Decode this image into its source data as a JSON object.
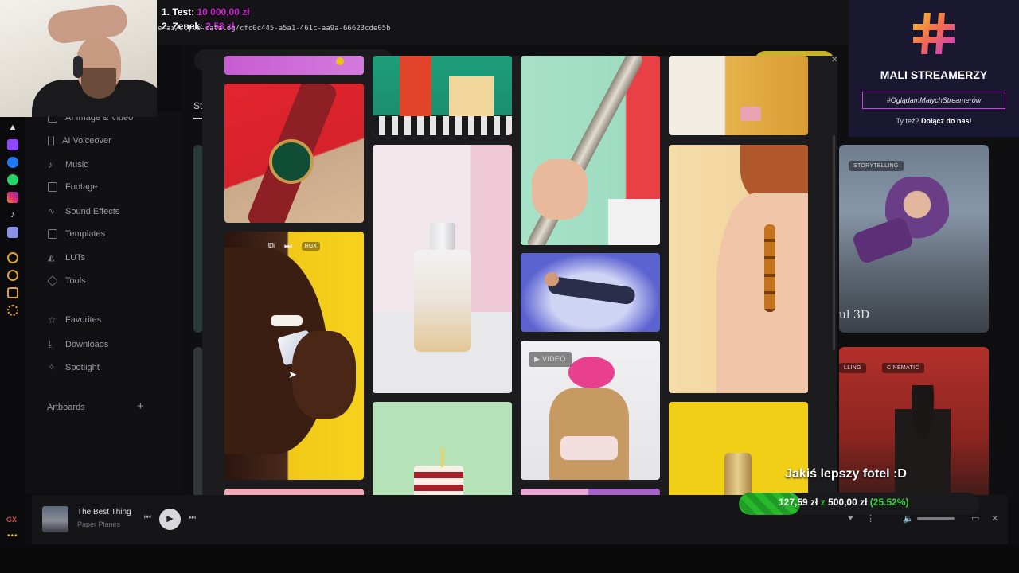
{
  "overlay": {
    "rank1": {
      "label": "1. Test:",
      "amount": "10 000,00 zł"
    },
    "rank2": {
      "label": "2. Zenek:",
      "amount": "2,58 zł"
    },
    "url_fragment": "e-ai/style-catalog/cfc0c445-a5a1-461c-aa9a-66623cde05b"
  },
  "sidebar": {
    "items": [
      {
        "label": "AI Image & Video",
        "icon": "sparkle-icon"
      },
      {
        "label": "AI Voiceover",
        "icon": "waveform-icon"
      },
      {
        "label": "Music",
        "icon": "music-note-icon"
      },
      {
        "label": "Footage",
        "icon": "film-icon"
      },
      {
        "label": "Sound Effects",
        "icon": "sound-wave-icon"
      },
      {
        "label": "Templates",
        "icon": "template-icon"
      },
      {
        "label": "LUTs",
        "icon": "lut-icon"
      },
      {
        "label": "Tools",
        "icon": "box-icon"
      },
      {
        "label": "Favorites",
        "icon": "star-icon"
      },
      {
        "label": "Downloads",
        "icon": "download-icon"
      },
      {
        "label": "Spotlight",
        "icon": "spotlight-icon"
      }
    ],
    "artboards_label": "Artboards",
    "tab_fragment": "St"
  },
  "modal": {
    "tile_actions": {
      "rgx": "RGX"
    },
    "video_badge": "VIDEO"
  },
  "cards": {
    "card1_tag": "STORYTELLING",
    "card1_title": "ul 3D",
    "card2_tags": [
      "LLING",
      "CINEMATIC"
    ]
  },
  "mali_streamerzy": {
    "title": "MALI STREAMERZY",
    "hashtag": "#OglądamMałychStreamerów",
    "join_prefix": "Ty też?",
    "join_cta": "Dołącz do nas!"
  },
  "goal": {
    "title": "Jakiś lepszy fotel :D",
    "current": "127,59 zł",
    "sep": "z",
    "target": "500,00 zł",
    "percent_label": "(25.52%)",
    "fraction": 0.2552
  },
  "player": {
    "track": "The Best Thing",
    "artist": "Paper Planes"
  },
  "browser": {
    "gx_label": "GX",
    "dots": "•••"
  }
}
